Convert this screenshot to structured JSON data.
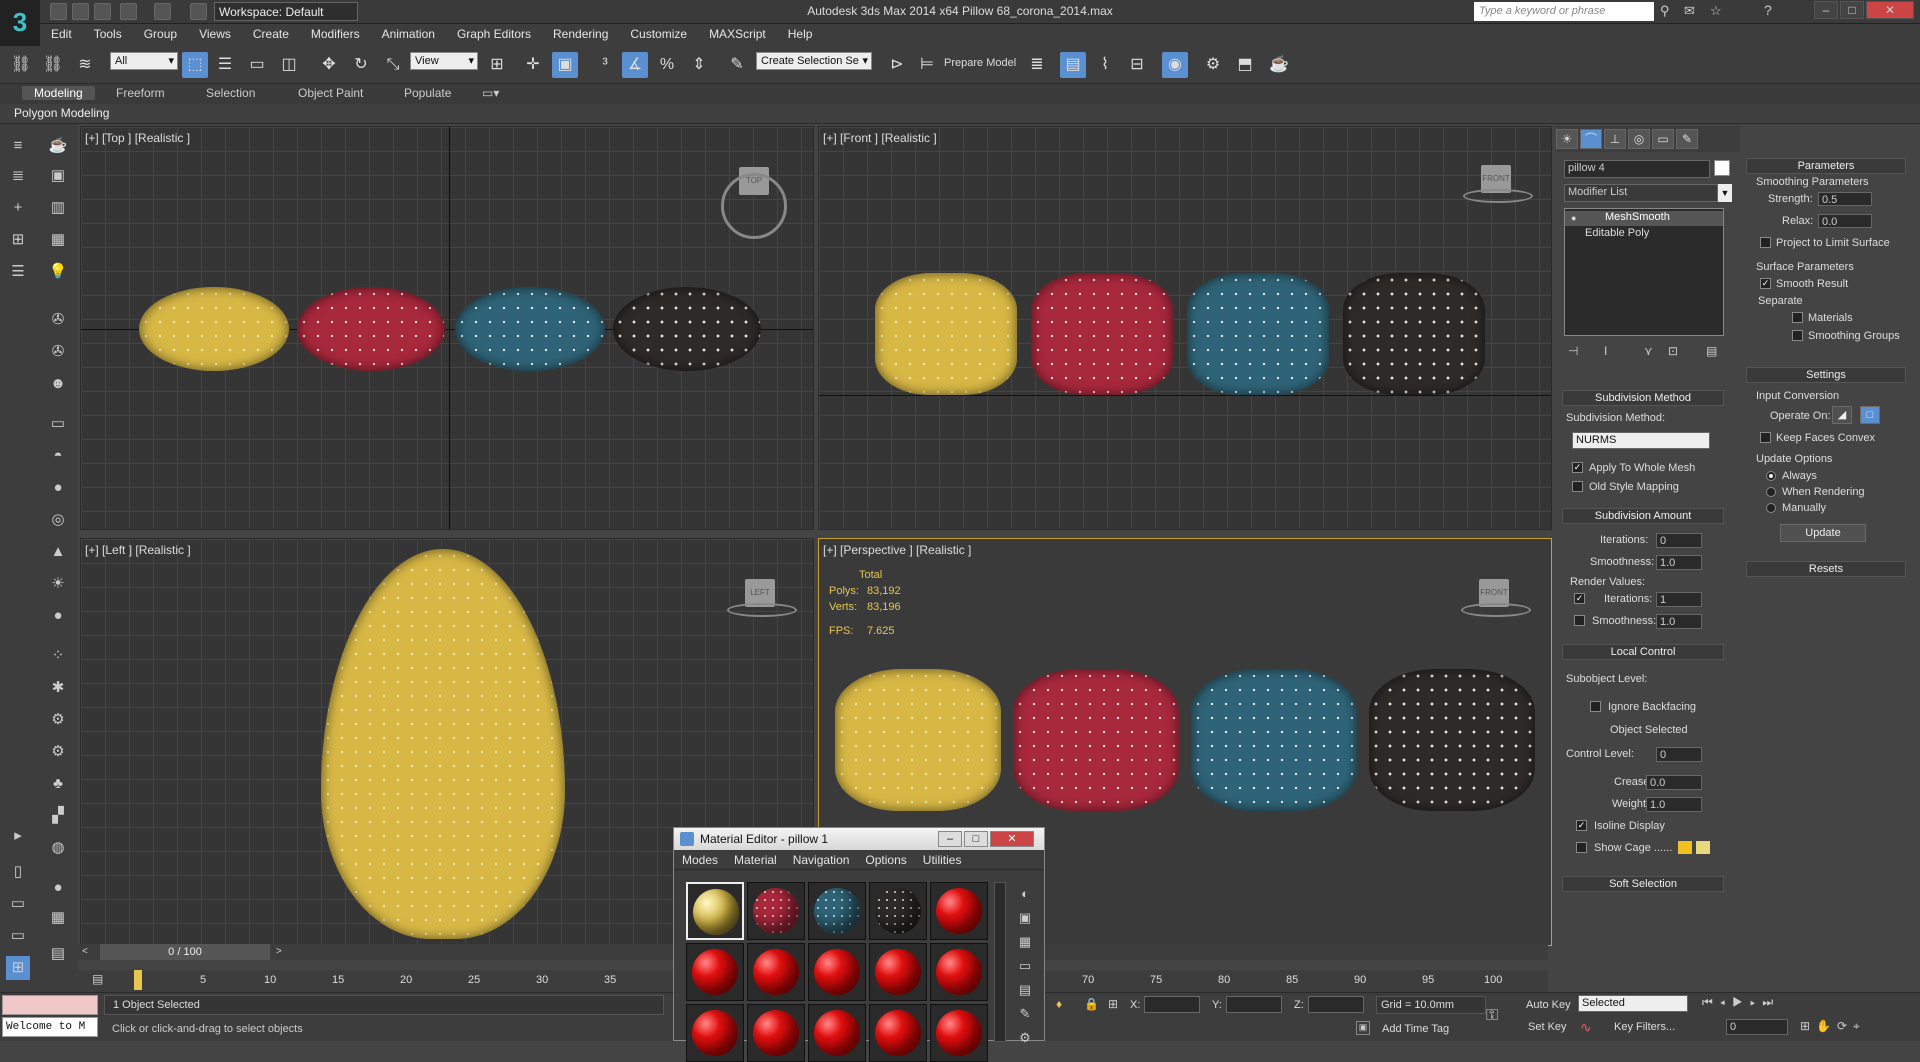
{
  "window": {
    "title": "Autodesk 3ds Max  2014 x64    Pillow 68_corona_2014.max",
    "workspace": "Workspace: Default",
    "search_placeholder": "Type a keyword or phrase"
  },
  "menu": [
    "Edit",
    "Tools",
    "Group",
    "Views",
    "Create",
    "Modifiers",
    "Animation",
    "Graph Editors",
    "Rendering",
    "Customize",
    "MAXScript",
    "Help"
  ],
  "toolbar": {
    "selection_filter": "All",
    "reference_coord": "View",
    "named_selection": "Create Selection Se",
    "prepare_model": "Prepare Model"
  },
  "ribbon": {
    "tabs": [
      "Modeling",
      "Freeform",
      "Selection",
      "Object Paint",
      "Populate"
    ],
    "panel": "Polygon Modeling"
  },
  "viewports": {
    "top": "[+] [Top ] [Realistic ]",
    "front": "[+] [Front ] [Realistic ]",
    "left": "[+] [Left ] [Realistic ]",
    "perspective": "[+] [Perspective ] [Realistic ]",
    "cube_top": "TOP",
    "cube_front": "FRONT",
    "cube_left": "LEFT",
    "cube_persp": "FRONT",
    "stats": {
      "header": "Total",
      "polys_label": "Polys:",
      "polys": "83,192",
      "verts_label": "Verts:",
      "verts": "83,196",
      "fps_label": "FPS:",
      "fps": "7.625"
    }
  },
  "command_panel": {
    "object_name": "pillow 4",
    "modifier_list": "Modifier List",
    "stack": [
      "MeshSmooth",
      "Editable Poly"
    ],
    "subdivision_method": {
      "title": "Subdivision Method",
      "label": "Subdivision Method:",
      "value": "NURMS",
      "apply_whole_mesh": "Apply To Whole Mesh",
      "old_style": "Old Style Mapping"
    },
    "subdivision_amount": {
      "title": "Subdivision Amount",
      "iterations_label": "Iterations:",
      "iterations": "0",
      "smoothness_label": "Smoothness:",
      "smoothness": "1.0",
      "render_values": "Render Values:",
      "r_iterations_label": "Iterations:",
      "r_iterations": "1",
      "r_smoothness_label": "Smoothness:",
      "r_smoothness": "1.0"
    },
    "local_control": {
      "title": "Local Control",
      "subobject_level": "Subobject Level:",
      "ignore_backfacing": "Ignore Backfacing",
      "object_selected": "Object Selected",
      "control_level_label": "Control Level:",
      "control_level": "0",
      "crease_label": "Crease:",
      "crease": "0.0",
      "weight_label": "Weight:",
      "weight": "1.0",
      "isoline": "Isoline Display",
      "show_cage": "Show Cage ......",
      "cage_colors": [
        "#f0c020",
        "#e8d880"
      ]
    },
    "soft_selection": "Soft Selection"
  },
  "params_panel": {
    "parameters": "Parameters",
    "smoothing_parameters": "Smoothing Parameters",
    "strength_label": "Strength:",
    "strength": "0.5",
    "relax_label": "Relax:",
    "relax": "0.0",
    "project_limit": "Project to Limit Surface",
    "surface_parameters": "Surface Parameters",
    "smooth_result": "Smooth Result",
    "separate": "Separate",
    "materials": "Materials",
    "smoothing_groups": "Smoothing Groups",
    "settings": "Settings",
    "input_conversion": "Input Conversion",
    "operate_on": "Operate On:",
    "keep_faces_convex": "Keep Faces Convex",
    "update_options": "Update Options",
    "always": "Always",
    "when_rendering": "When Rendering",
    "manually": "Manually",
    "update": "Update",
    "resets": "Resets"
  },
  "timeline": {
    "frame": "0 / 100",
    "ticks": [
      "0",
      "5",
      "10",
      "15",
      "20",
      "25",
      "30",
      "35",
      "70",
      "75",
      "80",
      "85",
      "90",
      "95",
      "100"
    ]
  },
  "status": {
    "maxscript": "Welcome to M",
    "selected": "1 Object Selected",
    "prompt": "Click or click-and-drag to select objects",
    "x_label": "X:",
    "y_label": "Y:",
    "z_label": "Z:",
    "grid": "Grid = 10.0mm",
    "add_time_tag": "Add Time Tag",
    "auto_key": "Auto Key",
    "set_key": "Set Key",
    "key_mode": "Selected",
    "key_filters": "Key Filters...",
    "current_frame": "0"
  },
  "material_editor": {
    "title": "Material Editor - pillow 1",
    "menu": [
      "Modes",
      "Material",
      "Navigation",
      "Options",
      "Utilities"
    ]
  }
}
